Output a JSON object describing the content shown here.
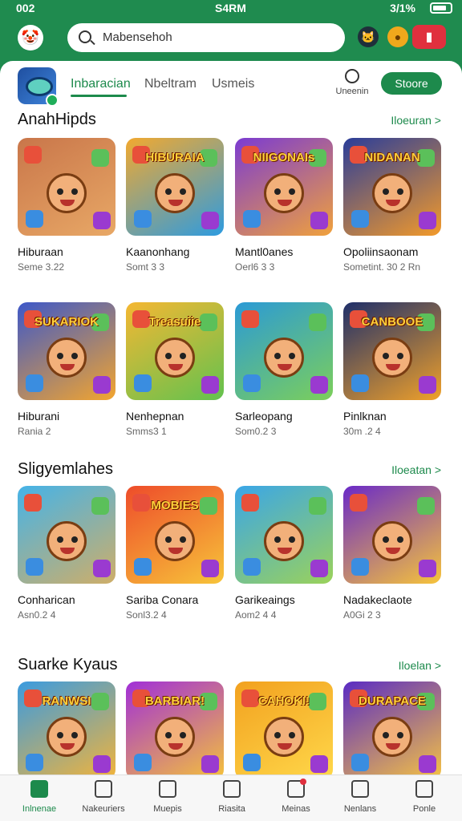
{
  "status": {
    "left": "002",
    "center": "S4RM",
    "right": "3/1%"
  },
  "search": {
    "text": "Mabensehoh"
  },
  "header_icons": [
    "cat-icon",
    "coin-icon",
    "gift-icon"
  ],
  "tabs": [
    {
      "label": "Inbaracian",
      "active": true
    },
    {
      "label": "Nbeltram",
      "active": false
    },
    {
      "label": "Usmeis",
      "active": false
    }
  ],
  "notification": {
    "label": "Uneenin"
  },
  "store_button": "Stoore",
  "sections": [
    {
      "title": "AnahHipds",
      "more": "Iloeuran >",
      "cards": [
        {
          "name": "Hiburaan",
          "meta": "Seme 3.22",
          "thumb": "",
          "colors": [
            "#c9764a",
            "#e8a866"
          ]
        },
        {
          "name": "Kaanonhang",
          "meta": "Somt 3 3",
          "thumb": "HIBURAIA",
          "colors": [
            "#f2a92f",
            "#2d9be0"
          ]
        },
        {
          "name": "Mantl0anes",
          "meta": "Oerl6 3 3",
          "thumb": "NIIGONAIs",
          "colors": [
            "#7b3bd2",
            "#f0a13c"
          ]
        },
        {
          "name": "Opoliinsaonam",
          "meta": "Sometint. 30 2 Rn",
          "thumb": "NIDANAN",
          "colors": [
            "#2a3d9a",
            "#f39a2a"
          ]
        }
      ]
    },
    {
      "title": "",
      "more": "",
      "cards": [
        {
          "name": "Hiburani",
          "meta": "Rania 2",
          "thumb": "SUKARIOK",
          "colors": [
            "#3d58c9",
            "#f3a52e"
          ]
        },
        {
          "name": "Nenhepnan",
          "meta": "Smms3 1",
          "thumb": "Treasuiie",
          "colors": [
            "#f5b733",
            "#62c24e"
          ]
        },
        {
          "name": "Sarleopang",
          "meta": "Som0.2 3",
          "thumb": "",
          "colors": [
            "#2b9ad6",
            "#7ccf5a"
          ]
        },
        {
          "name": "Pinlknan",
          "meta": "30m .2 4",
          "thumb": "CANBOOE",
          "colors": [
            "#1f2f6a",
            "#f0a12a"
          ]
        }
      ]
    },
    {
      "title": "Sligyemlahes",
      "more": "Iloeatan >",
      "cards": [
        {
          "name": "Conharican",
          "meta": "Asn0.2 4",
          "thumb": "",
          "colors": [
            "#45b3e8",
            "#cfae68"
          ]
        },
        {
          "name": "Sariba Conara",
          "meta": "Sonl3.2 4",
          "thumb": "MOBIES",
          "colors": [
            "#ee4c2a",
            "#f7c43a"
          ]
        },
        {
          "name": "Garikeaings",
          "meta": "Aom2 4 4",
          "thumb": "",
          "colors": [
            "#3aa6e8",
            "#9bd25a"
          ]
        },
        {
          "name": "Nadakeclaote",
          "meta": "A0Gi 2 3",
          "thumb": "",
          "colors": [
            "#6a2ac8",
            "#f7c43a"
          ]
        }
      ]
    },
    {
      "title": "Suarke Kyaus",
      "more": "Iloelan >",
      "cards": [
        {
          "name": "",
          "meta": "",
          "thumb": "RANWSI",
          "colors": [
            "#3a9be0",
            "#f3b43a"
          ]
        },
        {
          "name": "",
          "meta": "",
          "thumb": "BARBIAR!",
          "colors": [
            "#a12fd8",
            "#f5c23a"
          ]
        },
        {
          "name": "",
          "meta": "",
          "thumb": "CAHOKI!",
          "colors": [
            "#f2a11f",
            "#ffd84a"
          ]
        },
        {
          "name": "",
          "meta": "",
          "thumb": "DURAPACE",
          "colors": [
            "#5a2bc4",
            "#f6c343"
          ]
        }
      ]
    }
  ],
  "nav": [
    {
      "label": "Inlnenae",
      "icon": "home-icon",
      "active": true
    },
    {
      "label": "Nakeuriers",
      "icon": "list-icon",
      "active": false
    },
    {
      "label": "Muepis",
      "icon": "compass-icon",
      "active": false
    },
    {
      "label": "Riasita",
      "icon": "trophy-icon",
      "active": false
    },
    {
      "label": "Meinas",
      "icon": "message-icon",
      "active": false
    },
    {
      "label": "Nenlans",
      "icon": "search-icon",
      "active": false
    },
    {
      "label": "Ponle",
      "icon": "profile-icon",
      "active": false
    }
  ]
}
